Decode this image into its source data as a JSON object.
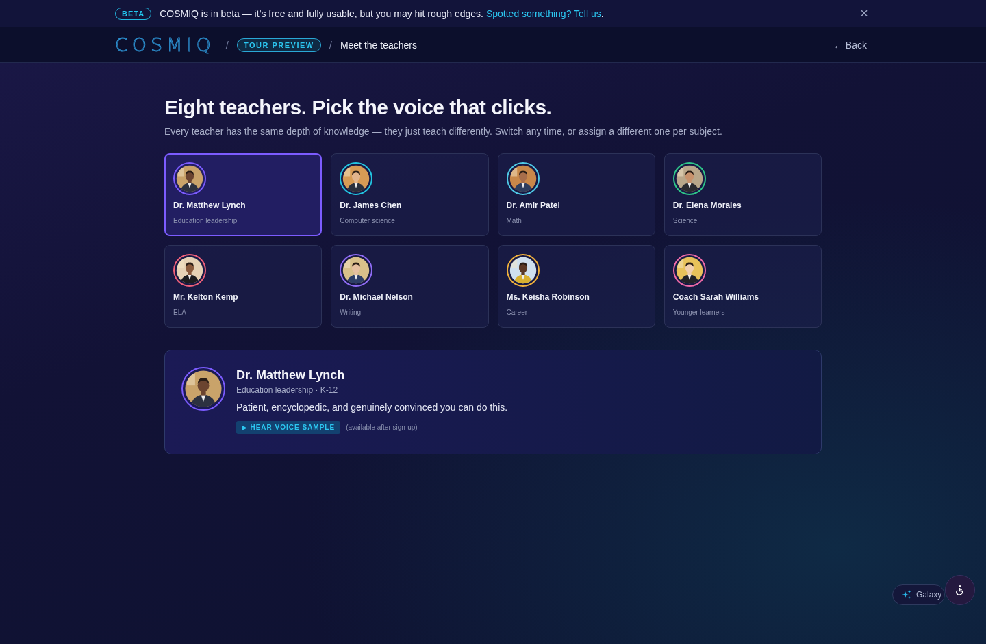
{
  "banner": {
    "badge": "BETA",
    "message": "COSMIQ is in beta — it’s free and fully usable, but you may hit rough edges.",
    "link": "Spotted something? Tell us",
    "end": ".",
    "close": "×"
  },
  "nav": {
    "logo": "COSMIQ",
    "separator": "/",
    "breadcrumb": [
      {
        "kind": "pill",
        "label": "TOUR PREVIEW"
      },
      {
        "kind": "text",
        "label": "Meet the teachers"
      }
    ],
    "back": "← Back"
  },
  "heading": "Eight teachers. Pick the voice that clicks.",
  "subheading": "Every teacher has the same depth of knowledge — they just teach differently. Switch any time, or assign a different one per subject.",
  "teachers": [
    {
      "name": "Dr. Matthew Lynch",
      "subject": "Education leadership",
      "color": "#7c5cff",
      "selected": true
    },
    {
      "name": "Dr. James Chen",
      "subject": "Computer science",
      "color": "#22c4e0",
      "selected": false
    },
    {
      "name": "Dr. Amir Patel",
      "subject": "Math",
      "color": "#4fc9e6",
      "selected": false
    },
    {
      "name": "Dr. Elena Morales",
      "subject": "Science",
      "color": "#2fc98a",
      "selected": false
    },
    {
      "name": "Mr. Kelton Kemp",
      "subject": "ELA",
      "color": "#f0607a",
      "selected": false
    },
    {
      "name": "Dr. Michael Nelson",
      "subject": "Writing",
      "color": "#8f6cf5",
      "selected": false
    },
    {
      "name": "Ms. Keisha Robinson",
      "subject": "Career",
      "color": "#f0b13c",
      "selected": false
    },
    {
      "name": "Coach Sarah Williams",
      "subject": "Younger learners",
      "color": "#f06aa8",
      "selected": false
    }
  ],
  "detail": {
    "name": "Dr. Matthew Lynch",
    "meta": "Education leadership · K-12",
    "tagline": "Patient, encyclopedic, and genuinely convinced you can do this.",
    "sample_button": "▶ HEAR VOICE SAMPLE",
    "sample_note": "(available after sign-up)",
    "color": "#7c5cff"
  },
  "galaxy_button": {
    "label": "Galaxy"
  }
}
